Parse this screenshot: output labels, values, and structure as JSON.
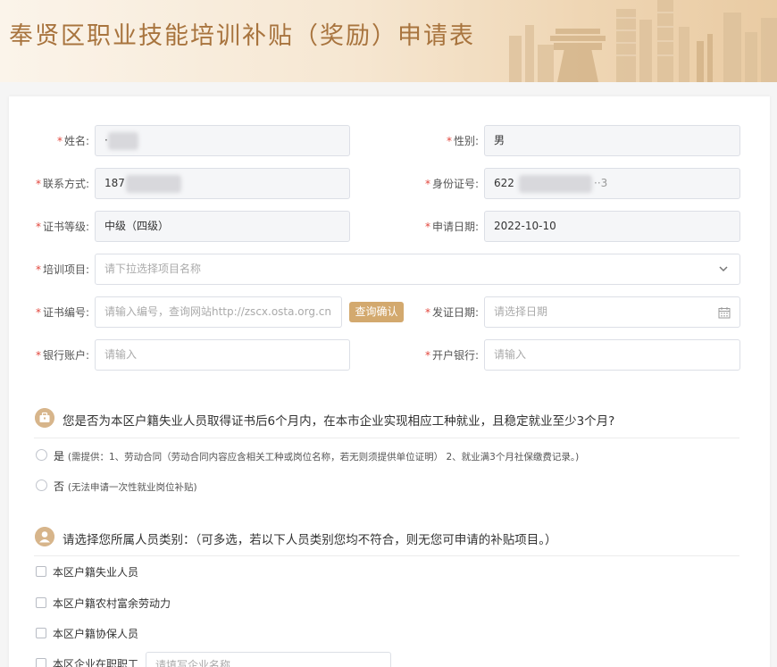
{
  "page_title": "奉贤区职业技能培训补贴（奖励）申请表",
  "form": {
    "name": {
      "label": "姓名:",
      "value": "·"
    },
    "gender": {
      "label": "性别:",
      "value": "男"
    },
    "phone": {
      "label": "联系方式:",
      "value": "187"
    },
    "id_number": {
      "label": "身份证号:",
      "value": "622",
      "value_tail": "··3"
    },
    "cert_level": {
      "label": "证书等级:",
      "value": "中级（四级）"
    },
    "apply_date": {
      "label": "申请日期:",
      "value": "2022-10-10"
    },
    "training_item": {
      "label": "培训项目:",
      "placeholder": "请下拉选择项目名称"
    },
    "cert_number": {
      "label": "证书编号:",
      "placeholder": "请输入编号，查询网站http://zscx.osta.org.cn",
      "button": "查询确认"
    },
    "issue_date": {
      "label": "发证日期:",
      "placeholder": "请选择日期"
    },
    "bank_account": {
      "label": "银行账户:",
      "placeholder": "请输入"
    },
    "bank_name": {
      "label": "开户银行:",
      "placeholder": "请输入"
    },
    "required_mark": "*"
  },
  "question1": {
    "text": "您是否为本区户籍失业人员取得证书后6个月内，在本市企业实现相应工种就业，且稳定就业至少3个月?",
    "options": [
      {
        "label": "是",
        "note": "(需提供：1、劳动合同（劳动合同内容应含相关工种或岗位名称，若无则须提供单位证明） 2、就业满3个月社保缴费记录。)"
      },
      {
        "label": "否",
        "note": "(无法申请一次性就业岗位补贴)"
      }
    ]
  },
  "question2": {
    "text": "请选择您所属人员类别：（可多选，若以下人员类别您均不符合，则无您可申请的补贴项目。）",
    "options": [
      {
        "label": "本区户籍失业人员"
      },
      {
        "label": "本区户籍农村富余劳动力"
      },
      {
        "label": "本区户籍协保人员"
      },
      {
        "label": "本区企业在职职工",
        "placeholder": "请填写企业名称"
      }
    ]
  },
  "colors": {
    "accent": "#d3a96e",
    "title": "#a8743e",
    "required": "#e2463c"
  },
  "icons": [
    "briefcase-icon",
    "user-icon",
    "chevron-down-icon",
    "calendar-icon"
  ]
}
